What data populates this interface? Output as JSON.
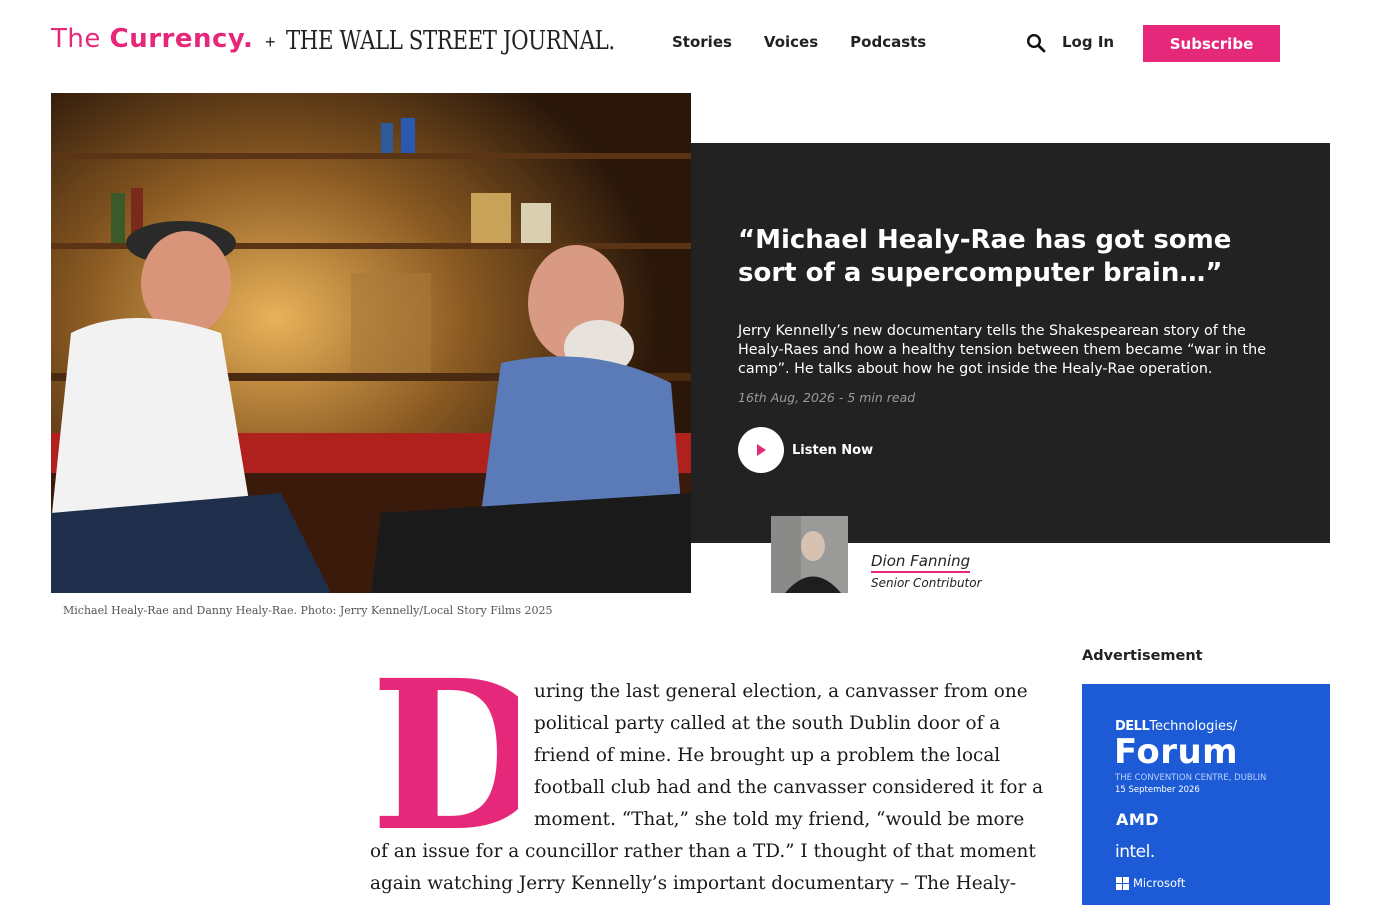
{
  "header": {
    "logo_the": "The ",
    "logo_currency": "Currency.",
    "logo_plus": "+",
    "logo_wsj": "THE WALL STREET JOURNAL.",
    "nav": [
      "Stories",
      "Voices",
      "Podcasts"
    ],
    "login_label": "Log In",
    "subscribe_label": "Subscribe"
  },
  "hero": {
    "caption": "Michael Healy-Rae and Danny Healy-Rae. Photo: Jerry Kennelly/Local Story Films 2025",
    "headline": "“Michael Healy-Rae has got some sort of a supercomputer brain…”",
    "standfirst": "Jerry Kennelly’s new documentary tells the Shakespearean story of the Healy-Raes and how a healthy tension between them became “war in the camp”. He talks about how he got inside the Healy-Rae operation.",
    "meta": "16th Aug, 2026 - 5 min read",
    "listen_label": "Listen Now"
  },
  "author": {
    "name": "Dion Fanning",
    "role": "Senior Contributor"
  },
  "article": {
    "dropcap": "D",
    "lines": [
      "uring the last general election, a canvasser from one",
      "political party called at the south Dublin door of a",
      "friend of mine. He brought up a problem the local",
      "football club had and the canvasser considered it for a",
      "moment. “That,” she told my friend, “would be more",
      "of an issue for a councillor rather than a TD.” I thought of that moment",
      "again watching Jerry Kennelly’s important documentary – The Healy-"
    ]
  },
  "ad": {
    "label": "Advertisement",
    "brand_dell": "DELL",
    "brand_tech": "Technologies",
    "title": "Forum",
    "venue": "THE CONVENTION CENTRE, DUBLIN",
    "date": "15 September 2026",
    "sponsor_amd": "AMD",
    "sponsor_intel": "intel.",
    "sponsor_ms": "Microsoft"
  },
  "colors": {
    "accent": "#e6287a",
    "panel": "#222222",
    "ad_blue": "#1d5bd6"
  },
  "icons": [
    "search-icon",
    "play-icon"
  ]
}
